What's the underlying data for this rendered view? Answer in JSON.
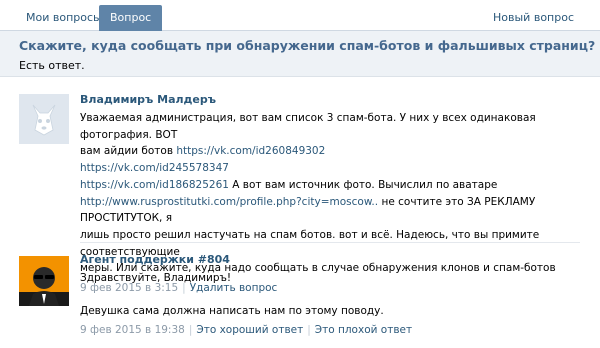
{
  "tabs": {
    "my_questions": "Мои вопросы",
    "question": "Вопрос",
    "new_question": "Новый вопрос"
  },
  "question": {
    "title": "Скажите, куда сообщать при обнаружении спам-ботов и фальшивых страниц?",
    "status": "Есть ответ."
  },
  "posts": [
    {
      "author": "Владимиръ Малдеръ",
      "text": {
        "l1": "Уважаемая администрация, вот вам список 3 спам-бота. У них у всех одинаковая фотография. ВОТ",
        "l2a": "вам айдии ботов ",
        "link1": "https://vk.com/id260849302",
        "link2": "https://vk.com/id245578347",
        "link3": "https://vk.com/id186825261",
        "l4b": " А вот вам источник фото. Вычислил по аватаре",
        "link4": "http://www.rusprostitutki.com/profile.php?city=moscow..",
        "l5b": " не сочтите это ЗА РЕКЛАМУ ПРОСТИТУТОК, я",
        "l6": "лишь просто решил настучать на спам ботов. вот и всё. Надеюсь, что вы примите соответствующие",
        "l7": "меры. Или скажите, куда надо сообщать в случае обнаружения клонов и спам-ботов"
      },
      "date": "9 фев 2015 в 3:15",
      "actions": [
        "Удалить вопрос"
      ]
    },
    {
      "author": "Агент поддержки #804",
      "text": {
        "l1": "Здравствуйте, Владимиръ!",
        "l2": "Девушка сама должна написать нам по этому поводу."
      },
      "date": "9 фев 2015 в 19:38",
      "actions": [
        "Это хороший ответ",
        "Это плохой ответ"
      ]
    }
  ],
  "icons": {
    "user_avatar": "vk-dog-avatar-icon",
    "agent_avatar": "support-agent-avatar-icon"
  },
  "colors": {
    "accent": "#5f84a8",
    "link": "#2b587a",
    "title": "#45688e",
    "meta": "#8c9aa8",
    "agent_bg": "#f39200"
  }
}
